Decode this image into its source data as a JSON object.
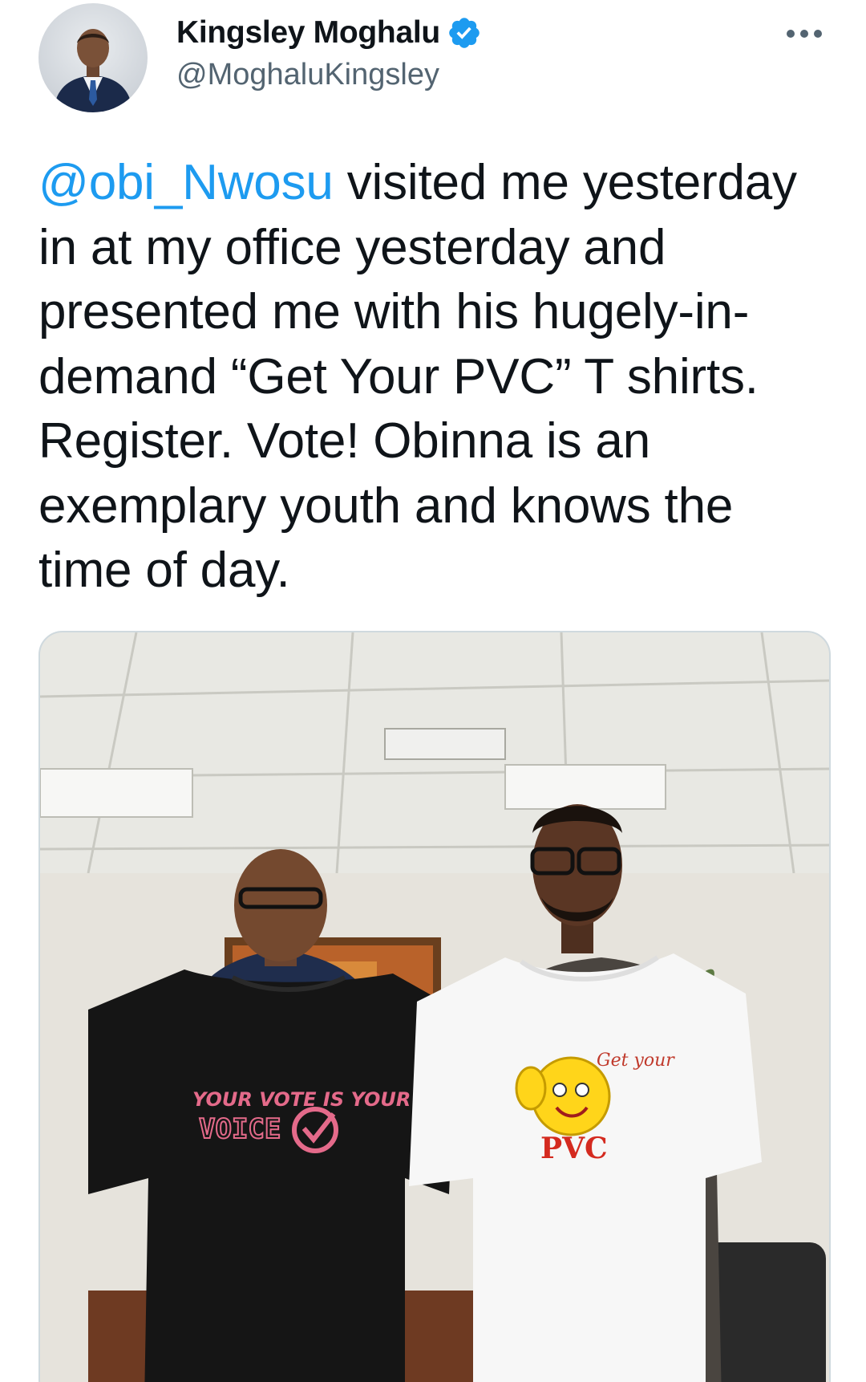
{
  "author": {
    "display_name": "Kingsley Moghalu",
    "handle": "@MoghaluKingsley",
    "verified": true,
    "avatar_icon": "profile-photo"
  },
  "more_icon": "more-options-icon",
  "tweet": {
    "mention": "@obi_Nwosu",
    "text": " visited me yesterday in at my office yesterday and presented me with his hugely-in-demand “Get Your PVC” T shirts. Register. Vote! Obinna is an exemplary youth and knows the time of day."
  },
  "media": {
    "left_shirt": {
      "line1": "YOUR VOTE IS YOUR",
      "line2": "VOICE"
    },
    "right_shirt": {
      "line1": "Get your",
      "line2": "PVC"
    }
  },
  "colors": {
    "mention": "#1d9bf0",
    "verified": "#1d9bf0",
    "text": "#0f1419",
    "secondary": "#536471"
  }
}
